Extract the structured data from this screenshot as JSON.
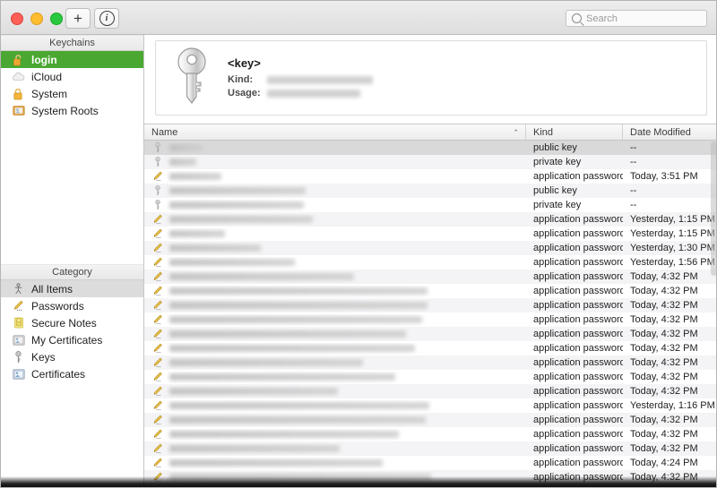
{
  "window": {
    "traffic_lights": [
      "close-button",
      "minimize-button",
      "zoom-button"
    ],
    "colors": {
      "selection_green": "#4aa832",
      "row_alt": "#f4f4f6",
      "row_selected": "#d9d9d9",
      "titlebar": "#e4e4e4"
    }
  },
  "toolbar": {
    "add_label": "+",
    "info_label": "i",
    "search_placeholder": "Search",
    "search_value": ""
  },
  "sidebar": {
    "keychains_header": "Keychains",
    "keychains": [
      {
        "label": "login",
        "icon": "unlocked-keychain-icon",
        "selected": true
      },
      {
        "label": "iCloud",
        "icon": "cloud-icon",
        "selected": false
      },
      {
        "label": "System",
        "icon": "lock-icon",
        "selected": false
      },
      {
        "label": "System Roots",
        "icon": "certificate-folder-icon",
        "selected": false
      }
    ],
    "category_header": "Category",
    "categories": [
      {
        "label": "All Items",
        "icon": "all-items-icon",
        "selected": true
      },
      {
        "label": "Passwords",
        "icon": "pencil-password-icon",
        "selected": false
      },
      {
        "label": "Secure Notes",
        "icon": "secure-note-icon",
        "selected": false
      },
      {
        "label": "My Certificates",
        "icon": "my-certificate-icon",
        "selected": false
      },
      {
        "label": "Keys",
        "icon": "key-icon",
        "selected": false
      },
      {
        "label": "Certificates",
        "icon": "certificate-icon",
        "selected": false
      }
    ]
  },
  "detail": {
    "icon": "key-large-icon",
    "title": "<key>",
    "kind_label": "Kind:",
    "kind_value_redacted": true,
    "kind_value_width": 118,
    "usage_label": "Usage:",
    "usage_value_redacted": true,
    "usage_value_width": 104
  },
  "table": {
    "columns": [
      {
        "label": "Name",
        "key": "name",
        "sorted": true,
        "sort_caret": "⌃"
      },
      {
        "label": "Kind",
        "key": "kind",
        "sorted": false
      },
      {
        "label": "Date Modified",
        "key": "date",
        "sorted": false
      }
    ],
    "rows": [
      {
        "icon": "key-icon",
        "name_redacted_width": 38,
        "kind": "public key",
        "date": "--",
        "selected": true
      },
      {
        "icon": "key-icon",
        "name_redacted_width": 30,
        "kind": "private key",
        "date": "--",
        "selected": false
      },
      {
        "icon": "pencil-password-icon",
        "name_redacted_width": 58,
        "kind": "application password",
        "date": "Today, 3:51 PM",
        "selected": false
      },
      {
        "icon": "key-icon",
        "name_redacted_width": 152,
        "kind": "public key",
        "date": "--",
        "selected": false
      },
      {
        "icon": "key-icon",
        "name_redacted_width": 150,
        "kind": "private key",
        "date": "--",
        "selected": false
      },
      {
        "icon": "pencil-password-icon",
        "name_redacted_width": 160,
        "kind": "application password",
        "date": "Yesterday, 1:15 PM",
        "selected": false
      },
      {
        "icon": "pencil-password-icon",
        "name_redacted_width": 62,
        "kind": "application password",
        "date": "Yesterday, 1:15 PM",
        "selected": false
      },
      {
        "icon": "pencil-password-icon",
        "name_redacted_width": 102,
        "kind": "application password",
        "date": "Yesterday, 1:30 PM",
        "selected": false
      },
      {
        "icon": "pencil-password-icon",
        "name_redacted_width": 140,
        "kind": "application password",
        "date": "Yesterday, 1:56 PM",
        "selected": false
      },
      {
        "icon": "pencil-password-icon",
        "name_redacted_width": 206,
        "kind": "application password",
        "date": "Today, 4:32 PM",
        "selected": false
      },
      {
        "icon": "pencil-password-icon",
        "name_redacted_width": 288,
        "kind": "application password",
        "date": "Today, 4:32 PM",
        "selected": false
      },
      {
        "icon": "pencil-password-icon",
        "name_redacted_width": 288,
        "kind": "application password",
        "date": "Today, 4:32 PM",
        "selected": false
      },
      {
        "icon": "pencil-password-icon",
        "name_redacted_width": 282,
        "kind": "application password",
        "date": "Today, 4:32 PM",
        "selected": false
      },
      {
        "icon": "pencil-password-icon",
        "name_redacted_width": 264,
        "kind": "application password",
        "date": "Today, 4:32 PM",
        "selected": false
      },
      {
        "icon": "pencil-password-icon",
        "name_redacted_width": 274,
        "kind": "application password",
        "date": "Today, 4:32 PM",
        "selected": false
      },
      {
        "icon": "pencil-password-icon",
        "name_redacted_width": 216,
        "kind": "application password",
        "date": "Today, 4:32 PM",
        "selected": false
      },
      {
        "icon": "pencil-password-icon",
        "name_redacted_width": 252,
        "kind": "application password",
        "date": "Today, 4:32 PM",
        "selected": false
      },
      {
        "icon": "pencil-password-icon",
        "name_redacted_width": 188,
        "kind": "application password",
        "date": "Today, 4:32 PM",
        "selected": false
      },
      {
        "icon": "pencil-password-icon",
        "name_redacted_width": 290,
        "kind": "application password",
        "date": "Yesterday, 1:16 PM",
        "selected": false
      },
      {
        "icon": "pencil-password-icon",
        "name_redacted_width": 286,
        "kind": "application password",
        "date": "Today, 4:32 PM",
        "selected": false
      },
      {
        "icon": "pencil-password-icon",
        "name_redacted_width": 256,
        "kind": "application password",
        "date": "Today, 4:32 PM",
        "selected": false
      },
      {
        "icon": "pencil-password-icon",
        "name_redacted_width": 190,
        "kind": "application password",
        "date": "Today, 4:32 PM",
        "selected": false
      },
      {
        "icon": "pencil-password-icon",
        "name_redacted_width": 238,
        "kind": "application password",
        "date": "Today, 4:24 PM",
        "selected": false
      },
      {
        "icon": "pencil-password-icon",
        "name_redacted_width": 292,
        "kind": "application password",
        "date": "Today, 4:32 PM",
        "selected": false
      }
    ]
  }
}
